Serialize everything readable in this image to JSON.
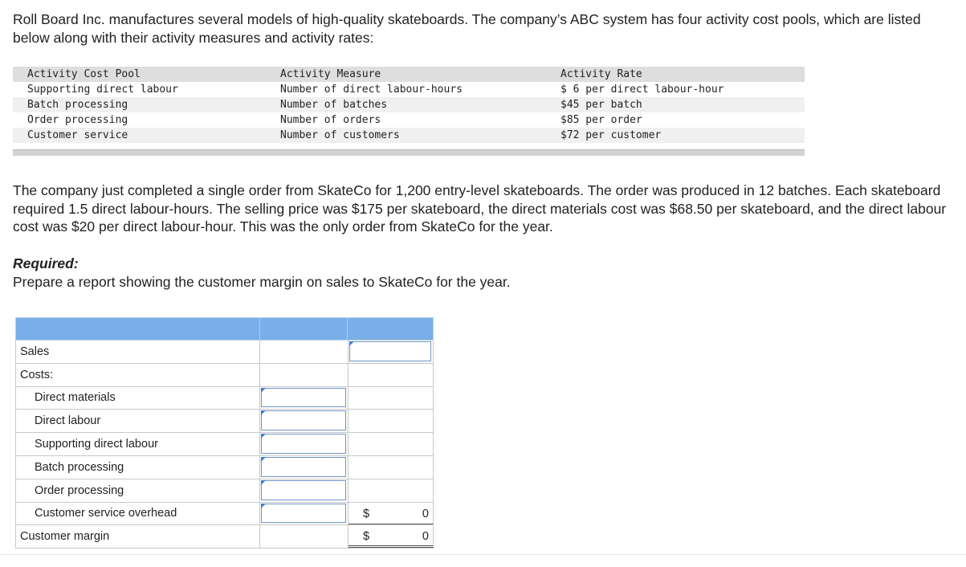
{
  "intro": "Roll Board Inc. manufactures several models of high-quality skateboards. The company’s ABC system has four activity cost pools, which are listed below along with their activity measures and activity rates:",
  "abc_table": {
    "headers": [
      "Activity Cost Pool",
      "Activity Measure",
      "Activity Rate"
    ],
    "rows": [
      [
        "Supporting direct labour",
        "Number of direct labour-hours",
        "$ 6 per direct labour-hour"
      ],
      [
        "Batch processing",
        "Number of batches",
        "$45 per batch"
      ],
      [
        "Order processing",
        "Number of orders",
        "$85 per order"
      ],
      [
        "Customer service",
        "Number of customers",
        "$72 per customer"
      ]
    ]
  },
  "scenario": "The company just completed a single order from SkateCo for 1,200 entry-level skateboards. The order was produced in 12 batches. Each skateboard required 1.5 direct labour-hours. The selling price was $175 per skateboard, the direct materials cost was $68.50 per skateboard, and the direct labour cost was $20 per direct labour-hour. This was the only order from SkateCo for the year.",
  "required_label": "Required:",
  "required_text": "Prepare a report showing the customer margin on sales to SkateCo for the year.",
  "answer_table": {
    "sales": "Sales",
    "costs": "Costs:",
    "cost_items": [
      "Direct materials",
      "Direct labour",
      "Supporting direct labour",
      "Batch processing",
      "Order processing",
      "Customer service overhead"
    ],
    "customer_margin": "Customer margin",
    "currency": "$",
    "costs_total": "0",
    "margin_total": "0"
  }
}
